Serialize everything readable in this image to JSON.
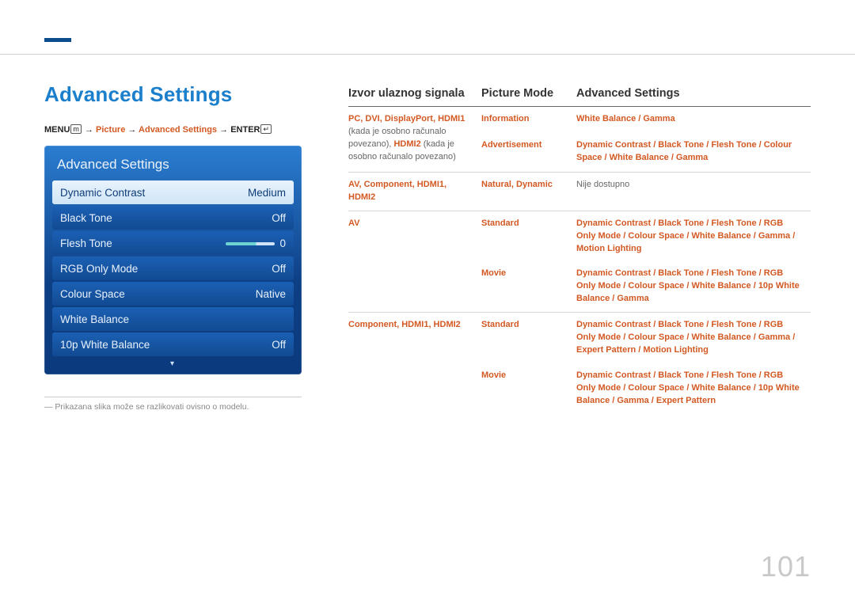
{
  "page_number": "101",
  "section_title": "Advanced Settings",
  "breadcrumb": {
    "menu": "MENU",
    "arrow": " → ",
    "picture": "Picture",
    "advanced": "Advanced Settings",
    "enter": "ENTER"
  },
  "osd": {
    "title": "Advanced Settings",
    "rows": [
      {
        "label": "Dynamic Contrast",
        "value": "Medium",
        "highlight": true
      },
      {
        "label": "Black Tone",
        "value": "Off"
      },
      {
        "label": "Flesh Tone",
        "value": "0",
        "slider": true
      },
      {
        "label": "RGB Only Mode",
        "value": "Off"
      },
      {
        "label": "Colour Space",
        "value": "Native"
      },
      {
        "label": "White Balance",
        "value": ""
      },
      {
        "label": "10p White Balance",
        "value": "Off"
      }
    ],
    "more": "▾"
  },
  "footnote": "― Prikazana slika može se razlikovati ovisno o modelu.",
  "table": {
    "headers": [
      "Izvor ulaznog signala",
      "Picture Mode",
      "Advanced Settings"
    ],
    "rows": [
      {
        "c1": {
          "main": "PC, DVI, DisplayPort, HDMI1",
          "note": " (kada je osobno računalo povezano), ",
          "main2": "HDMI2",
          "note2": " (kada je osobno računalo povezano)"
        },
        "c2a": "Information",
        "c3a": "White Balance / Gamma",
        "c2b": "Advertisement",
        "c3b": "Dynamic Contrast / Black Tone / Flesh Tone / Colour Space / White Balance / Gamma"
      },
      {
        "c1": {
          "main": "AV, Component, HDMI1, HDMI2"
        },
        "c2": "Natural, Dynamic",
        "c3_plain": "Nije dostupno"
      },
      {
        "c1": {
          "main": "AV"
        },
        "c2a": "Standard",
        "c3a": "Dynamic Contrast / Black Tone / Flesh Tone / RGB Only Mode / Colour Space / White Balance / Gamma / Motion Lighting",
        "c2b": "Movie",
        "c3b": "Dynamic Contrast / Black Tone / Flesh Tone / RGB Only Mode / Colour Space / White Balance / 10p White Balance / Gamma"
      },
      {
        "c1": {
          "main": "Component, HDMI1, HDMI2"
        },
        "c2a": "Standard",
        "c3a": "Dynamic Contrast / Black Tone / Flesh Tone / RGB Only Mode / Colour Space / White Balance / Gamma / Expert Pattern / Motion Lighting",
        "c2b": "Movie",
        "c3b": "Dynamic Contrast / Black Tone / Flesh Tone / RGB Only Mode / Colour Space / White Balance / 10p White Balance / Gamma / Expert Pattern"
      }
    ]
  }
}
